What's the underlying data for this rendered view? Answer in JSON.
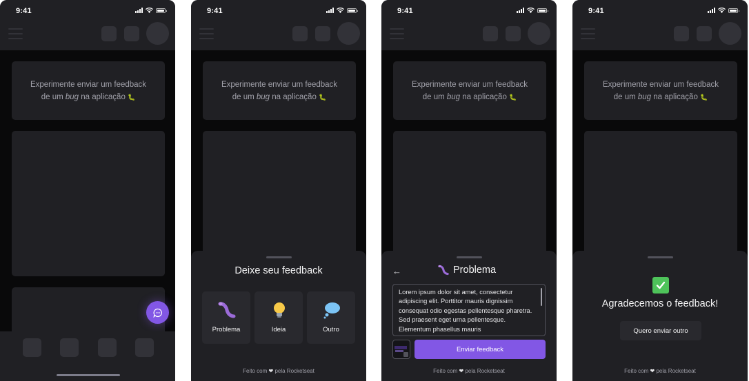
{
  "status": {
    "time": "9:41"
  },
  "page": {
    "message_line1": "Experimente enviar um feedback",
    "message_line2_prefix": "de um ",
    "message_line2_bug": "bug",
    "message_line2_suffix": " na aplicação",
    "message_emoji": "🐛"
  },
  "widget": {
    "title": "Deixe seu feedback",
    "options": [
      {
        "label": "Problema",
        "icon": "bug-icon"
      },
      {
        "label": "Ideia",
        "icon": "lightbulb-icon"
      },
      {
        "label": "Outro",
        "icon": "thought-bubble-icon"
      }
    ],
    "footer_prefix": "Feito com ",
    "footer_heart": "❤",
    "footer_suffix": " pela Rocketseat"
  },
  "problem_form": {
    "title": "Problema",
    "textarea_value": "Lorem ipsum dolor sit amet, consectetur adipiscing elit. Porttitor mauris dignissim consequat odio egestas pellentesque pharetra. Sed praesent eget urna pellentesque. Elementum phasellus mauris",
    "submit_label": "Enviar feedback"
  },
  "success": {
    "title": "Agradecemos o feedback!",
    "again_label": "Quero enviar outro"
  },
  "colors": {
    "brand": "#8257e5",
    "surface": "#202024",
    "background": "#09090a",
    "success": "#4ec35a"
  }
}
